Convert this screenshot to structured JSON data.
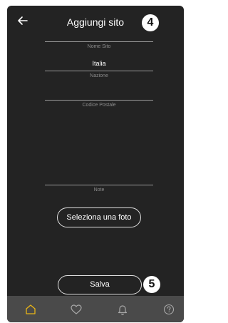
{
  "header": {
    "title": "Aggiungi sito",
    "step_badge": "4"
  },
  "form": {
    "nome_sito": {
      "label": "Nome Sito",
      "value": ""
    },
    "nazione": {
      "label": "Nazione",
      "value": "Italia"
    },
    "codice_postale": {
      "label": "Codice Postale",
      "value": ""
    },
    "note": {
      "label": "Note",
      "value": ""
    }
  },
  "buttons": {
    "select_photo": "Seleziona una foto",
    "save": "Salva",
    "save_badge": "5"
  },
  "bottom_nav": {
    "items": [
      {
        "icon": "home-icon",
        "active": true
      },
      {
        "icon": "heart-icon",
        "active": false
      },
      {
        "icon": "bell-icon",
        "active": false
      },
      {
        "icon": "help-icon",
        "active": false
      }
    ]
  },
  "colors": {
    "background": "#232323",
    "nav_background": "#4a4a4a",
    "accent": "#e8b417"
  }
}
